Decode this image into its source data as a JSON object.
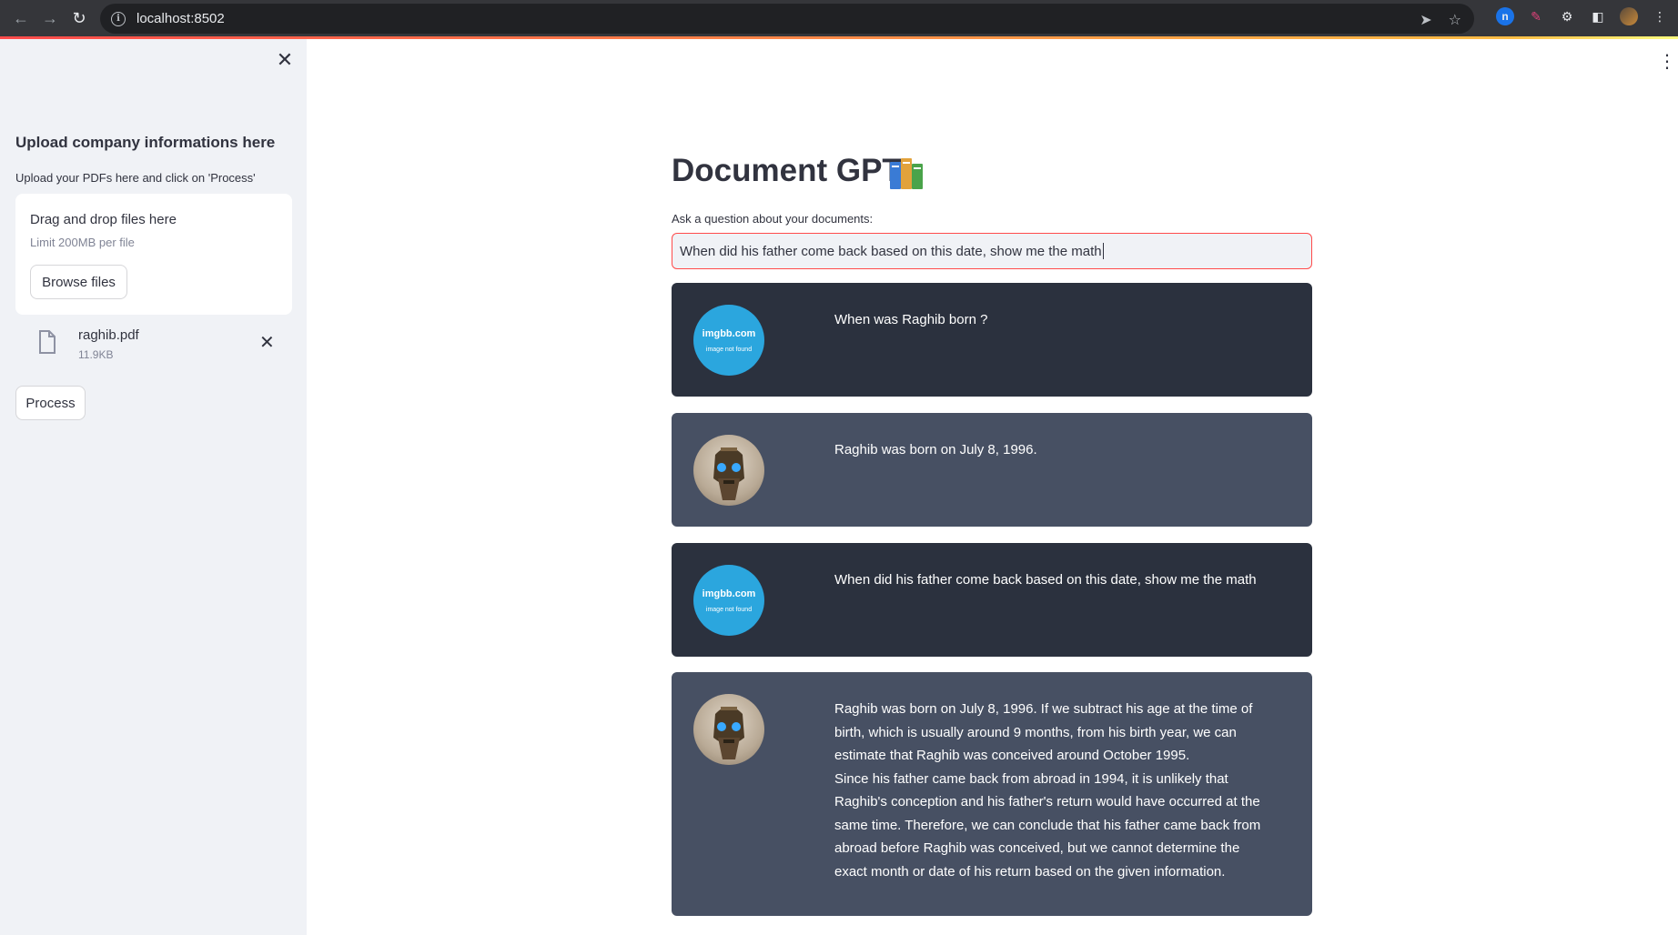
{
  "browser": {
    "url": "localhost:8502"
  },
  "sidebar": {
    "title": "Upload company informations here",
    "upload_label": "Upload your PDFs here and click on 'Process'",
    "dropzone": {
      "title": "Drag and drop files here",
      "limit": "Limit 200MB per file",
      "browse_label": "Browse files"
    },
    "file": {
      "name": "raghib.pdf",
      "size": "11.9KB"
    },
    "process_label": "Process"
  },
  "main": {
    "title": "Document GPT",
    "title_emoji": "books-icon",
    "question_label": "Ask a question about your documents:",
    "question_value": "When did his father come back based on this date, show me the math"
  },
  "chat": {
    "user_avatar": {
      "brand": "imgbb.com",
      "sub": "image not found"
    },
    "messages": [
      {
        "role": "user",
        "text": "When was Raghib born ?"
      },
      {
        "role": "bot",
        "text": "Raghib was born on July 8, 1996."
      },
      {
        "role": "user",
        "text": "When did his father come back based on this date, show me the math"
      },
      {
        "role": "bot",
        "text1": "Raghib was born on July 8, 1996. If we subtract his age at the time of birth, which is usually around 9 months, from his birth year, we can estimate that Raghib was conceived around October 1995.",
        "text2": "Since his father came back from abroad in 1994, it is unlikely that Raghib's conception and his father's return would have occurred at the same time. Therefore, we can conclude that his father came back from abroad before Raghib was conceived, but we cannot determine the exact month or date of his return based on the given information."
      }
    ]
  },
  "colors": {
    "accent": "#ff4b4b",
    "sidebar_bg": "#f0f2f6",
    "user_msg_bg": "#2b313e",
    "bot_msg_bg": "#475063",
    "user_avatar_bg": "#2ba6de"
  }
}
